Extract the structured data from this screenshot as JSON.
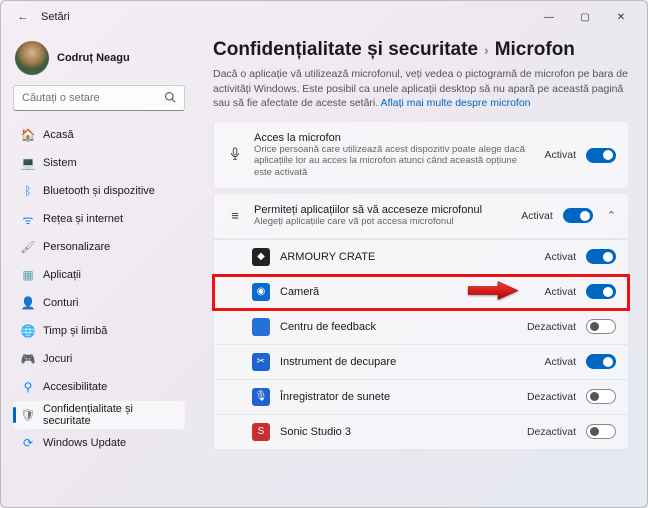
{
  "window": {
    "title": "Setări"
  },
  "profile": {
    "name": "Codruț Neagu"
  },
  "search": {
    "placeholder": "Căutați o setare"
  },
  "sidebar": {
    "items": [
      {
        "label": "Acasă"
      },
      {
        "label": "Sistem"
      },
      {
        "label": "Bluetooth și dispozitive"
      },
      {
        "label": "Rețea și internet"
      },
      {
        "label": "Personalizare"
      },
      {
        "label": "Aplicații"
      },
      {
        "label": "Conturi"
      },
      {
        "label": "Timp și limbă"
      },
      {
        "label": "Jocuri"
      },
      {
        "label": "Accesibilitate"
      },
      {
        "label": "Confidențialitate și securitate"
      },
      {
        "label": "Windows Update"
      }
    ]
  },
  "breadcrumb": {
    "parent": "Confidențialitate și securitate",
    "sep": "›",
    "current": "Microfon"
  },
  "desc": {
    "text": "Dacă o aplicație vă utilizează microfonul, veți vedea o pictogramă de microfon pe bara de activități Windows. Este posibil ca unele aplicații desktop să nu apară pe această pagină sau să fie afectate de aceste setări. ",
    "link": "Aflați mai multe despre microfon"
  },
  "access": {
    "title": "Acces la microfon",
    "sub": "Orice persoană care utilizează acest dispozitiv poate alege dacă aplicațiile lor au acces la microfon atunci când această opțiune este activată",
    "state": "Activat"
  },
  "allow": {
    "title": "Permiteți aplicațiilor să vă acceseze microfonul",
    "sub": "Alegeți aplicațiile care vă pot accesa microfonul",
    "state": "Activat"
  },
  "apps": [
    {
      "name": "ARMOURY CRATE",
      "state": "Activat",
      "on": true,
      "bg": "#222"
    },
    {
      "name": "Cameră",
      "state": "Activat",
      "on": true,
      "bg": "#0b6bd4",
      "highlight": true
    },
    {
      "name": "Centru de feedback",
      "state": "Dezactivat",
      "on": false,
      "bg": "#2a6fd6"
    },
    {
      "name": "Instrument de decupare",
      "state": "Activat",
      "on": true,
      "bg": "#1e63d0"
    },
    {
      "name": "Înregistrator de sunete",
      "state": "Dezactivat",
      "on": false,
      "bg": "#1e63d0"
    },
    {
      "name": "Sonic Studio 3",
      "state": "Dezactivat",
      "on": false,
      "bg": "#c83030"
    }
  ]
}
